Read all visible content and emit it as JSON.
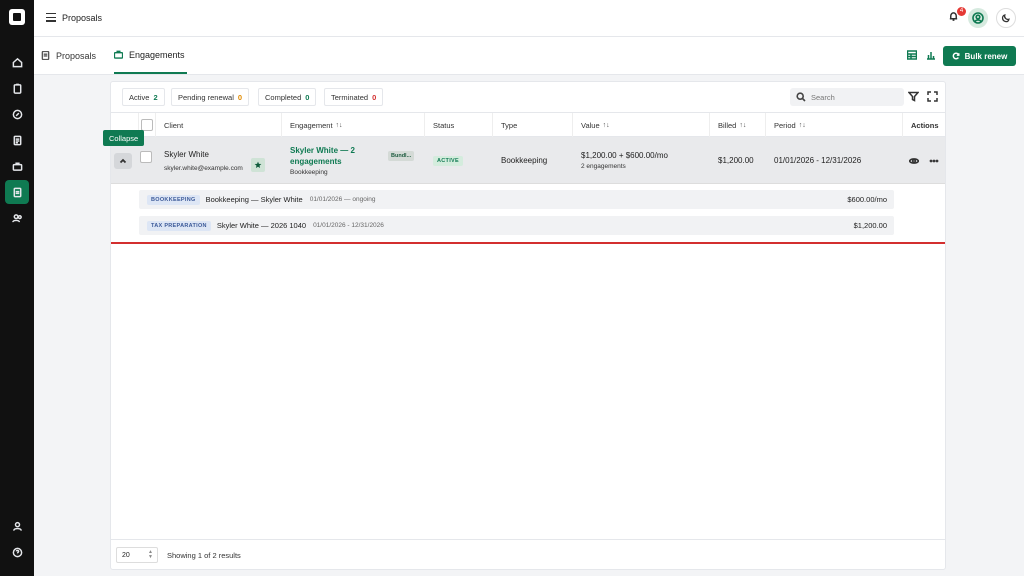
{
  "topbar": {
    "title": "Proposals",
    "notification_count": "4"
  },
  "tabs": [
    {
      "label": "Proposals"
    },
    {
      "label": "Engagements"
    }
  ],
  "toolbar": {
    "bulk_renew_label": "Bulk renew"
  },
  "filters": [
    {
      "label": "Active",
      "count": "2"
    },
    {
      "label": "Pending renewal",
      "count": "0"
    },
    {
      "label": "Completed",
      "count": "0"
    },
    {
      "label": "Terminated",
      "count": "0"
    }
  ],
  "search": {
    "placeholder": "Search"
  },
  "table": {
    "headers": {
      "client": "Client",
      "engagement": "Engagement",
      "status": "Status",
      "type": "Type",
      "value": "Value",
      "billed": "Billed",
      "period": "Period",
      "actions": "Actions"
    },
    "sort_glyph": "↑↓",
    "row": {
      "tooltip": "Collapse",
      "client_name": "Skyler White",
      "client_email": "skyler.white@example.com",
      "engagement_title": "Skyler White — 2 engagements",
      "engagement_sub": "Bookkeeping",
      "bundle_tag": "Bundl...",
      "status": "ACTIVE",
      "type": "Bookkeeping",
      "value_main": "$1,200.00 + $600.00/mo",
      "value_sub": "2 engagements",
      "billed": "$1,200.00",
      "period": "01/01/2026 - 12/31/2026"
    },
    "sub_rows": [
      {
        "tag": "BOOKKEEPING",
        "title": "Bookkeeping — Skyler White",
        "dates": "01/01/2026 — ongoing",
        "amount": "$600.00/mo"
      },
      {
        "tag": "TAX PREPARATION",
        "title": "Skyler White — 2026 1040",
        "dates": "01/01/2026 - 12/31/2026",
        "amount": "$1,200.00"
      }
    ]
  },
  "footer": {
    "page_size": "20",
    "results_text": "Showing 1 of 2 results"
  }
}
